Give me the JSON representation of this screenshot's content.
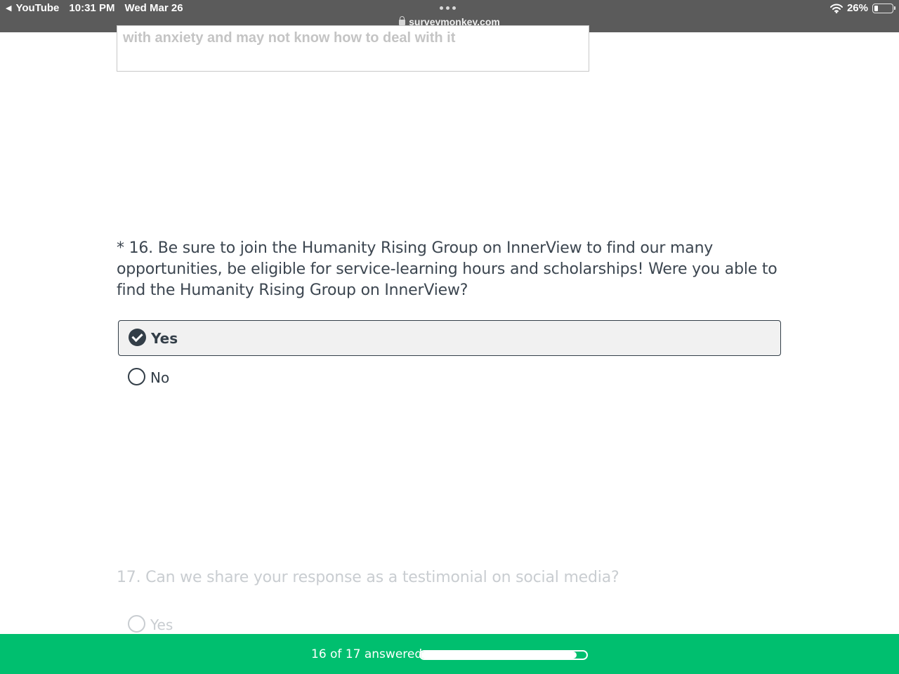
{
  "status_bar": {
    "back_app": "YouTube",
    "time": "10:31 PM",
    "date": "Wed Mar 26",
    "url": "surveymonkey.com",
    "battery": "26%",
    "battery_level": 0.26
  },
  "previous_answer": {
    "text": "with anxiety and may not know how to deal with it"
  },
  "question_16": {
    "title": "* 16. Be sure to join the Humanity Rising Group on InnerView to find our many opportunities, be eligible for service-learning hours and scholarships! Were you able to find the Humanity Rising Group on InnerView?",
    "options": [
      {
        "label": "Yes",
        "selected": true
      },
      {
        "label": "No",
        "selected": false
      }
    ]
  },
  "question_17": {
    "title": "17. Can we share your response as a testimonial on social media?",
    "options": [
      {
        "label": "Yes",
        "selected": false
      }
    ]
  },
  "progress": {
    "text": "16 of 17 answered",
    "answered": 16,
    "total": 17
  },
  "colors": {
    "brand_green": "#00bf6f",
    "text_dark": "#333e48",
    "status_bar": "#5b5b5b"
  }
}
